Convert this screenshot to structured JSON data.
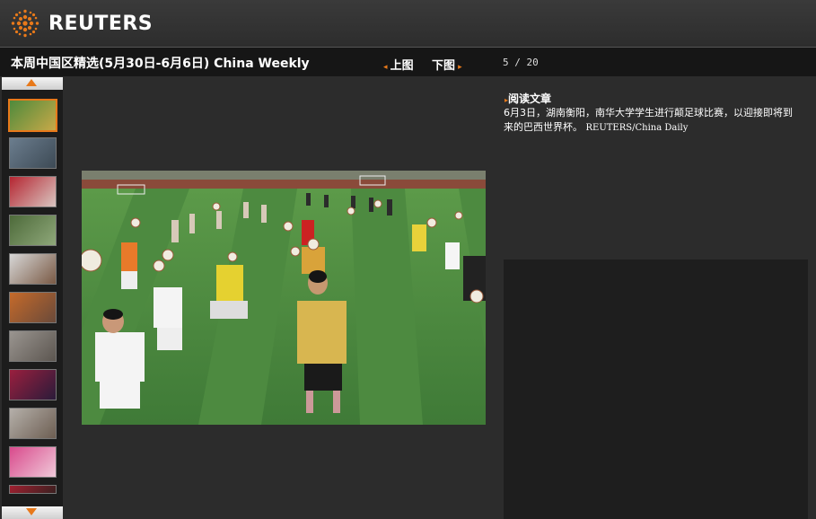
{
  "brand": {
    "name": "REUTERS",
    "logo_icon": "reuters-dot-sphere-icon",
    "accent": "#e8791a"
  },
  "gallery": {
    "title": "本周中国区精选(5月30日-6月6日) China Weekly",
    "prev_label": "上图",
    "next_label": "下图",
    "counter": "5 / 20"
  },
  "article": {
    "read_label": "阅读文章",
    "caption": "6月3日，湖南衡阳，南华大学学生进行颠足球比赛，以迎接即将到来的巴西世界杯。",
    "credit": "REUTERS/China Daily"
  },
  "thumbnails": [
    {
      "name": "thumb-football-field",
      "selected": true,
      "colors": [
        "#4e8a3c",
        "#c8a948"
      ]
    },
    {
      "name": "thumb-city-street",
      "selected": false,
      "colors": [
        "#6b7d8e",
        "#3d4a55"
      ]
    },
    {
      "name": "thumb-red-ribbons",
      "selected": false,
      "colors": [
        "#b52531",
        "#d9c6c1"
      ]
    },
    {
      "name": "thumb-forest",
      "selected": false,
      "colors": [
        "#4d6a3a",
        "#8fa87a"
      ]
    },
    {
      "name": "thumb-truck",
      "selected": false,
      "colors": [
        "#d7d7d7",
        "#7a5a45"
      ]
    },
    {
      "name": "thumb-crowd",
      "selected": false,
      "colors": [
        "#c56a2a",
        "#6a4a3a"
      ]
    },
    {
      "name": "thumb-ruins",
      "selected": false,
      "colors": [
        "#9a9590",
        "#5c5650"
      ]
    },
    {
      "name": "thumb-stage",
      "selected": false,
      "colors": [
        "#9a1f3e",
        "#2a1b3a"
      ]
    },
    {
      "name": "thumb-market",
      "selected": false,
      "colors": [
        "#b5b0aa",
        "#6d5e52"
      ]
    },
    {
      "name": "thumb-pink-display",
      "selected": false,
      "colors": [
        "#d94a8c",
        "#f0c9d9"
      ]
    },
    {
      "name": "thumb-partial",
      "selected": false,
      "colors": [
        "#a02030",
        "#3a2020"
      ]
    }
  ]
}
